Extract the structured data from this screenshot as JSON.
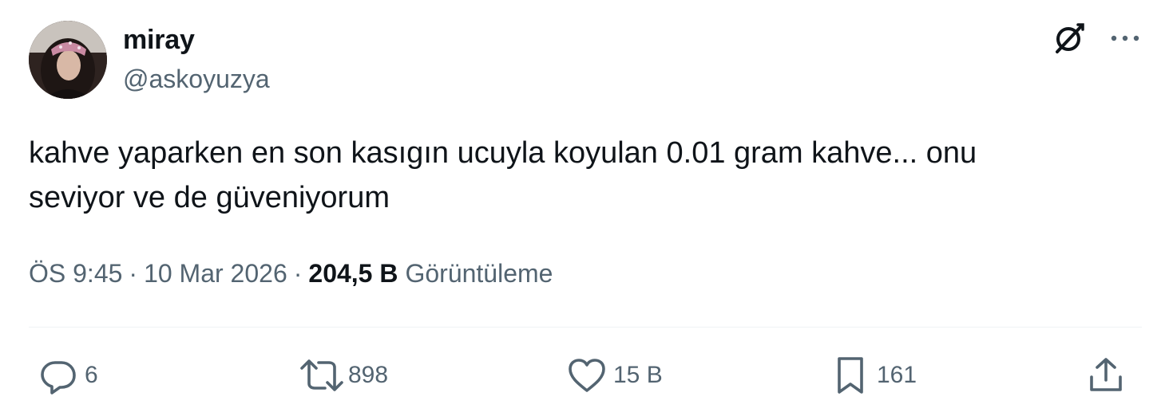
{
  "author": {
    "display_name": "miray",
    "handle": "@askoyuzya"
  },
  "tweet": {
    "text": "kahve yaparken en son kasıgın ucuyla koyulan 0.01 gram kahve... onu\nseviyor ve de güveniyorum"
  },
  "meta": {
    "time": "ÖS 9:45",
    "separator": "·",
    "date": "10 Mar 2026",
    "views_count": "204,5 B",
    "views_label": "Görüntüleme"
  },
  "actions": {
    "replies": "6",
    "reposts": "898",
    "likes": "15 B",
    "bookmarks": "161"
  },
  "icons": {
    "grok": "grok-icon",
    "more": "more-icon",
    "reply": "reply-icon",
    "repost": "repost-icon",
    "like": "like-icon",
    "bookmark": "bookmark-icon",
    "share": "share-icon"
  },
  "colors": {
    "text_primary": "#0f1419",
    "text_secondary": "#536471",
    "divider": "#eff3f4"
  }
}
